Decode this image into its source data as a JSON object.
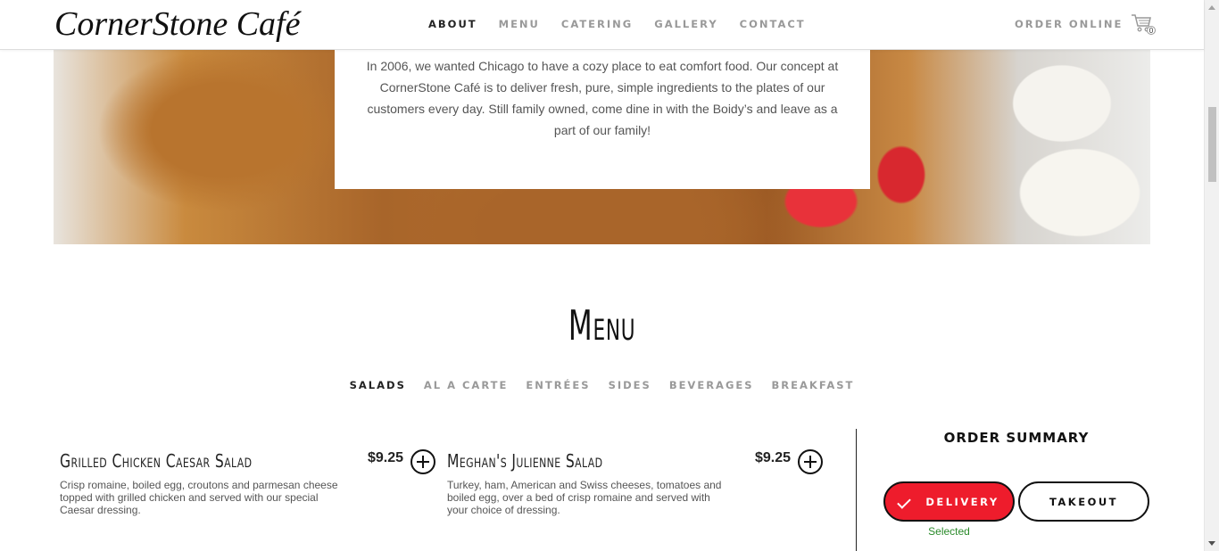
{
  "header": {
    "logo": "CornerStone Café",
    "nav": [
      "ABOUT",
      "MENU",
      "CATERING",
      "GALLERY",
      "CONTACT"
    ],
    "active_nav": "ABOUT",
    "order_online": "ORDER ONLINE",
    "cart_count": "0"
  },
  "about": {
    "text": "In 2006, we wanted Chicago to have a cozy place to eat comfort food. Our concept at CornerStone Café is to deliver fresh, pure, simple ingredients to the plates of our customers every day. Still family owned, come dine in with the Boidy’s and leave as a part of our family!"
  },
  "menu": {
    "title": "Menu",
    "tabs": [
      "SALADS",
      "AL A CARTE",
      "ENTRÉES",
      "SIDES",
      "BEVERAGES",
      "BREAKFAST"
    ],
    "active_tab": "SALADS",
    "items": [
      {
        "name": "Grilled Chicken Caesar Salad",
        "price": "$9.25",
        "description": "Crisp romaine, boiled egg, croutons and parmesan cheese topped with grilled chicken and served with our special Caesar dressing."
      },
      {
        "name": "Meghan's Julienne Salad",
        "price": "$9.25",
        "description": "Turkey, ham, American and Swiss cheeses, tomatoes and boiled egg, over a bed of crisp romaine and served with your choice of dressing."
      }
    ]
  },
  "order_summary": {
    "title": "ORDER SUMMARY",
    "delivery_label": "DELIVERY",
    "takeout_label": "TAKEOUT",
    "selected_label": "Selected"
  },
  "colors": {
    "accent_red": "#ee1c2c",
    "selected_green": "#2a8a2a"
  }
}
